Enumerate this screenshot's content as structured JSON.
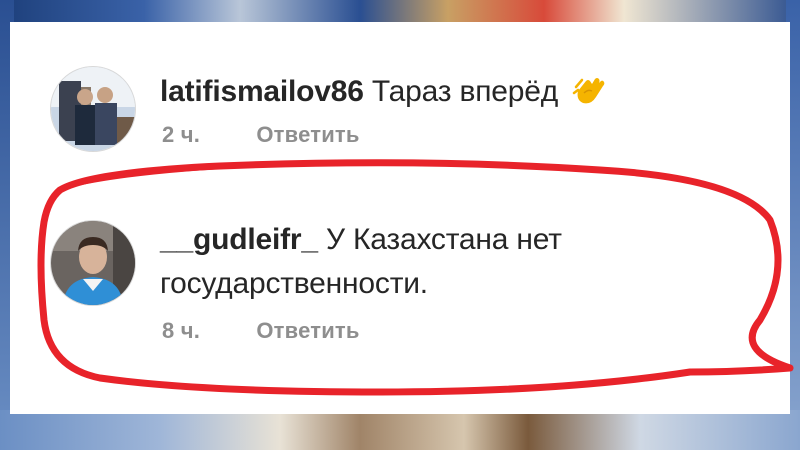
{
  "comments": [
    {
      "username": "latifismailov86",
      "text": "Тараз вперёд",
      "emoji": "clapping-hands-icon",
      "time": "2 ч.",
      "reply": "Ответить"
    },
    {
      "username": "__gudleifr_",
      "text_line1": "У Казахстана нет",
      "text_line2": "государственности.",
      "time": "8 ч.",
      "reply": "Ответить"
    }
  ],
  "colors": {
    "text": "#262626",
    "meta": "#8e8e8e",
    "highlight": "#e8232a",
    "emoji": "#f5b400"
  }
}
